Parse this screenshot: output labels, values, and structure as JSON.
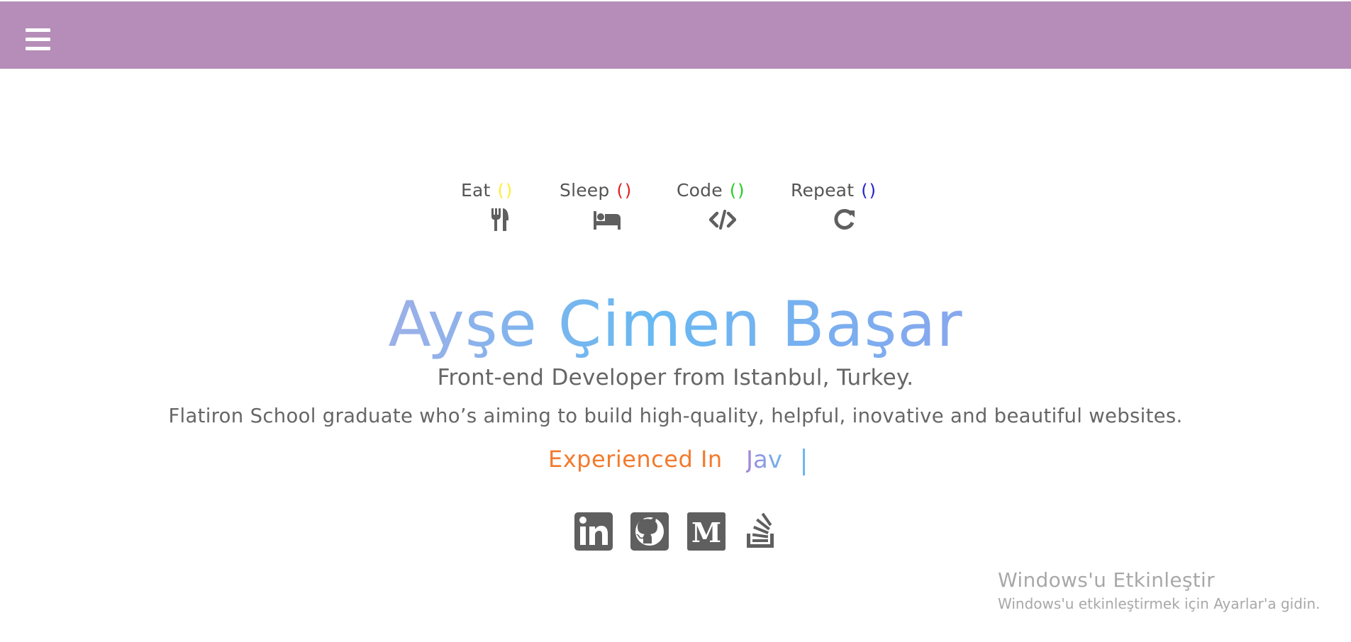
{
  "header": {
    "menu_icon": "hamburger-menu-icon",
    "color": "#b58db8"
  },
  "routine": {
    "items": [
      {
        "label": "Eat",
        "parens": "()",
        "paren_color": "#ffee33",
        "icon": "fork-knife-icon"
      },
      {
        "label": "Sleep",
        "parens": "()",
        "paren_color": "#dd2222",
        "icon": "bed-icon"
      },
      {
        "label": "Code",
        "parens": "()",
        "paren_color": "#22cc22",
        "icon": "code-icon"
      },
      {
        "label": "Repeat",
        "parens": "()",
        "paren_color": "#2222cc",
        "icon": "redo-icon"
      }
    ]
  },
  "hero": {
    "name": "Ayşe Çimen Başar",
    "subtitle": "Front-end Developer from Istanbul, Turkey.",
    "bio": "Flatiron School graduate who’s aiming to build high-quality, helpful, inovative and beautiful websites.",
    "experienced_label": "Experienced In",
    "typing_text": "Jav"
  },
  "socials": [
    {
      "name": "linkedin-icon"
    },
    {
      "name": "github-icon"
    },
    {
      "name": "medium-icon"
    },
    {
      "name": "stackoverflow-icon"
    }
  ],
  "watermark": {
    "title": "Windows'u Etkinleştir",
    "subtitle": "Windows'u etkinleştirmek için Ayarlar'a gidin."
  },
  "colors": {
    "accent_orange": "#f47a2c",
    "text_gray": "#666666",
    "icon_gray": "#5f5f5f"
  }
}
